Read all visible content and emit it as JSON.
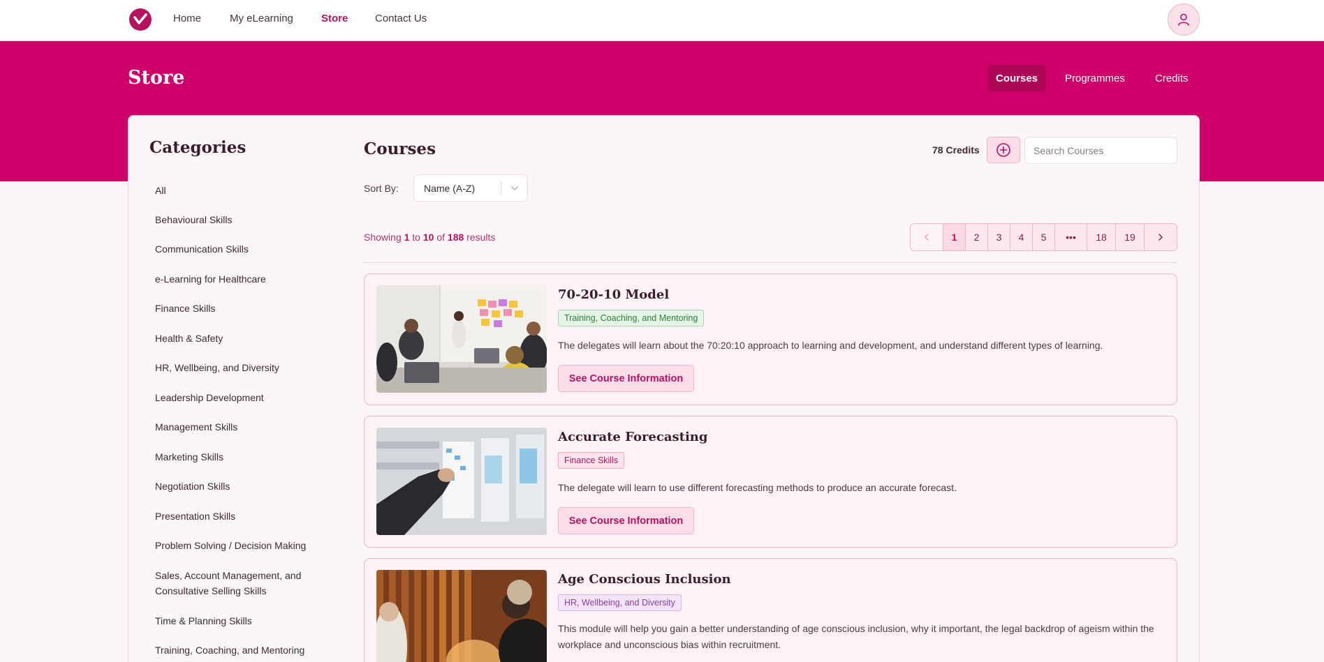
{
  "nav": {
    "links": [
      "Home",
      "My eLearning",
      "Store",
      "Contact Us"
    ],
    "active": "Store"
  },
  "banner": {
    "title": "Store",
    "tabs": [
      "Courses",
      "Programmes",
      "Credits"
    ],
    "active_tab": "Courses"
  },
  "sidebar": {
    "title": "Categories",
    "items": [
      "All",
      "Behavioural Skills",
      "Communication Skills",
      "e-Learning for Healthcare",
      "Finance Skills",
      "Health & Safety",
      "HR, Wellbeing, and Diversity",
      "Leadership Development",
      "Management Skills",
      "Marketing Skills",
      "Negotiation Skills",
      "Presentation Skills",
      "Problem Solving / Decision Making",
      "Sales, Account Management, and Consultative Selling Skills",
      "Time & Planning Skills",
      "Training, Coaching, and Mentoring"
    ]
  },
  "courses": {
    "title": "Courses",
    "credits": "78 Credits",
    "search_placeholder": "Search Courses",
    "sort_label": "Sort By:",
    "sort_value": "Name (A-Z)",
    "showing": {
      "prefix": "Showing",
      "from": "1",
      "to_word": "to",
      "to": "10",
      "of_word": "of",
      "total": "188",
      "suffix": "results"
    },
    "pagination": [
      "1",
      "2",
      "3",
      "4",
      "5",
      "•••",
      "18",
      "19"
    ],
    "current_page": "1",
    "button_label": "See Course Information",
    "items": [
      {
        "title": "70-20-10 Model",
        "tag": "Training, Coaching, and Mentoring",
        "tag_color": "#2f7d3c",
        "description": "The delegates will learn about the 70:20:10 approach to learning and development, and understand different types of learning."
      },
      {
        "title": "Accurate Forecasting",
        "tag": "Finance Skills",
        "tag_color": "#b5125f",
        "description": "The delegate will learn to use different forecasting methods to produce an accurate forecast."
      },
      {
        "title": "Age Conscious Inclusion",
        "tag": "HR, Wellbeing, and Diversity",
        "tag_color": "#8b3ea8",
        "description": "This module will help you gain a better understanding of age conscious inclusion, why it important, the legal backdrop of ageism within the workplace and unconscious bias within recruitment."
      }
    ]
  },
  "colors": {
    "brand": "#cc0068",
    "accent": "#b5125f",
    "background": "#fdf6f8"
  }
}
